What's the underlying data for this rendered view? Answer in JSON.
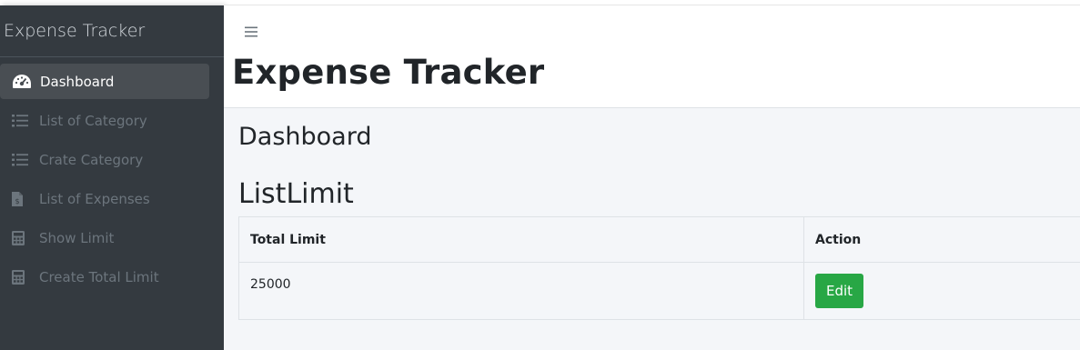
{
  "sidebar": {
    "brand": "Expense Tracker",
    "items": [
      {
        "label": "Dashboard",
        "icon": "dashboard-gauge-icon",
        "active": true
      },
      {
        "label": "List of Category",
        "icon": "list-icon"
      },
      {
        "label": "Crate Category",
        "icon": "list-icon"
      },
      {
        "label": "List of Expenses",
        "icon": "file-invoice-icon"
      },
      {
        "label": "Show Limit",
        "icon": "calculator-icon"
      },
      {
        "label": "Create Total Limit",
        "icon": "calculator-icon"
      }
    ]
  },
  "header": {
    "menu_icon": "hamburger-icon",
    "title": "Expense Tracker"
  },
  "main": {
    "page_heading": "Dashboard",
    "section_heading": "ListLimit",
    "table": {
      "columns": [
        "Total Limit",
        "Action"
      ],
      "rows": [
        {
          "total_limit": "25000",
          "action_label": "Edit"
        }
      ]
    }
  },
  "colors": {
    "sidebar_bg": "#343a40",
    "active_item_bg": "#494e53",
    "content_bg": "#f4f6f9",
    "edit_button": "#28a745"
  }
}
